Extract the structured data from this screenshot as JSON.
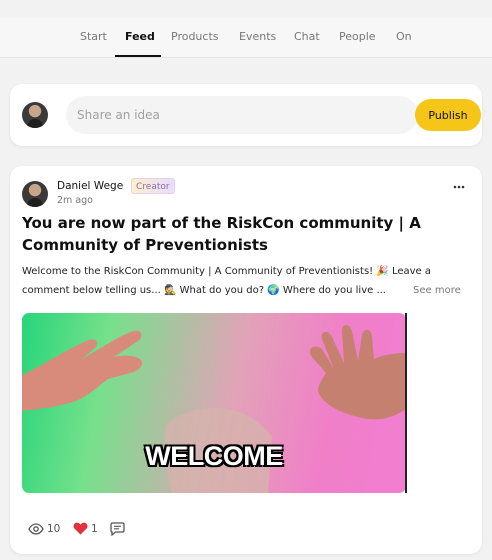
{
  "nav": {
    "tabs": [
      {
        "label": "Start"
      },
      {
        "label": "Feed"
      },
      {
        "label": "Products"
      },
      {
        "label": "Events"
      },
      {
        "label": "Chat"
      },
      {
        "label": "People"
      },
      {
        "label": "On"
      }
    ],
    "active_tab": "Feed"
  },
  "composer": {
    "placeholder": "Share an idea",
    "publish_label": "Publish",
    "publish_color": "#f5c518"
  },
  "post": {
    "author": "Daniel Wege",
    "badge": "Creator",
    "time": "2m ago",
    "title": "You are now part of the RiskCon community | A Community of Preventionists",
    "body": "Welcome to the RiskCon Community | A Community of Preventionists! 🎉 Leave a comment below telling us... 🕵 What do you do? 🌍 Where do you live ...",
    "see_more": "See more",
    "media_caption": "WELCOME",
    "stats": {
      "views": "10",
      "likes": "1"
    },
    "icons": [
      "eye-icon",
      "heart-icon",
      "comment-icon",
      "more-icon"
    ],
    "like_color": "#e0313d"
  }
}
